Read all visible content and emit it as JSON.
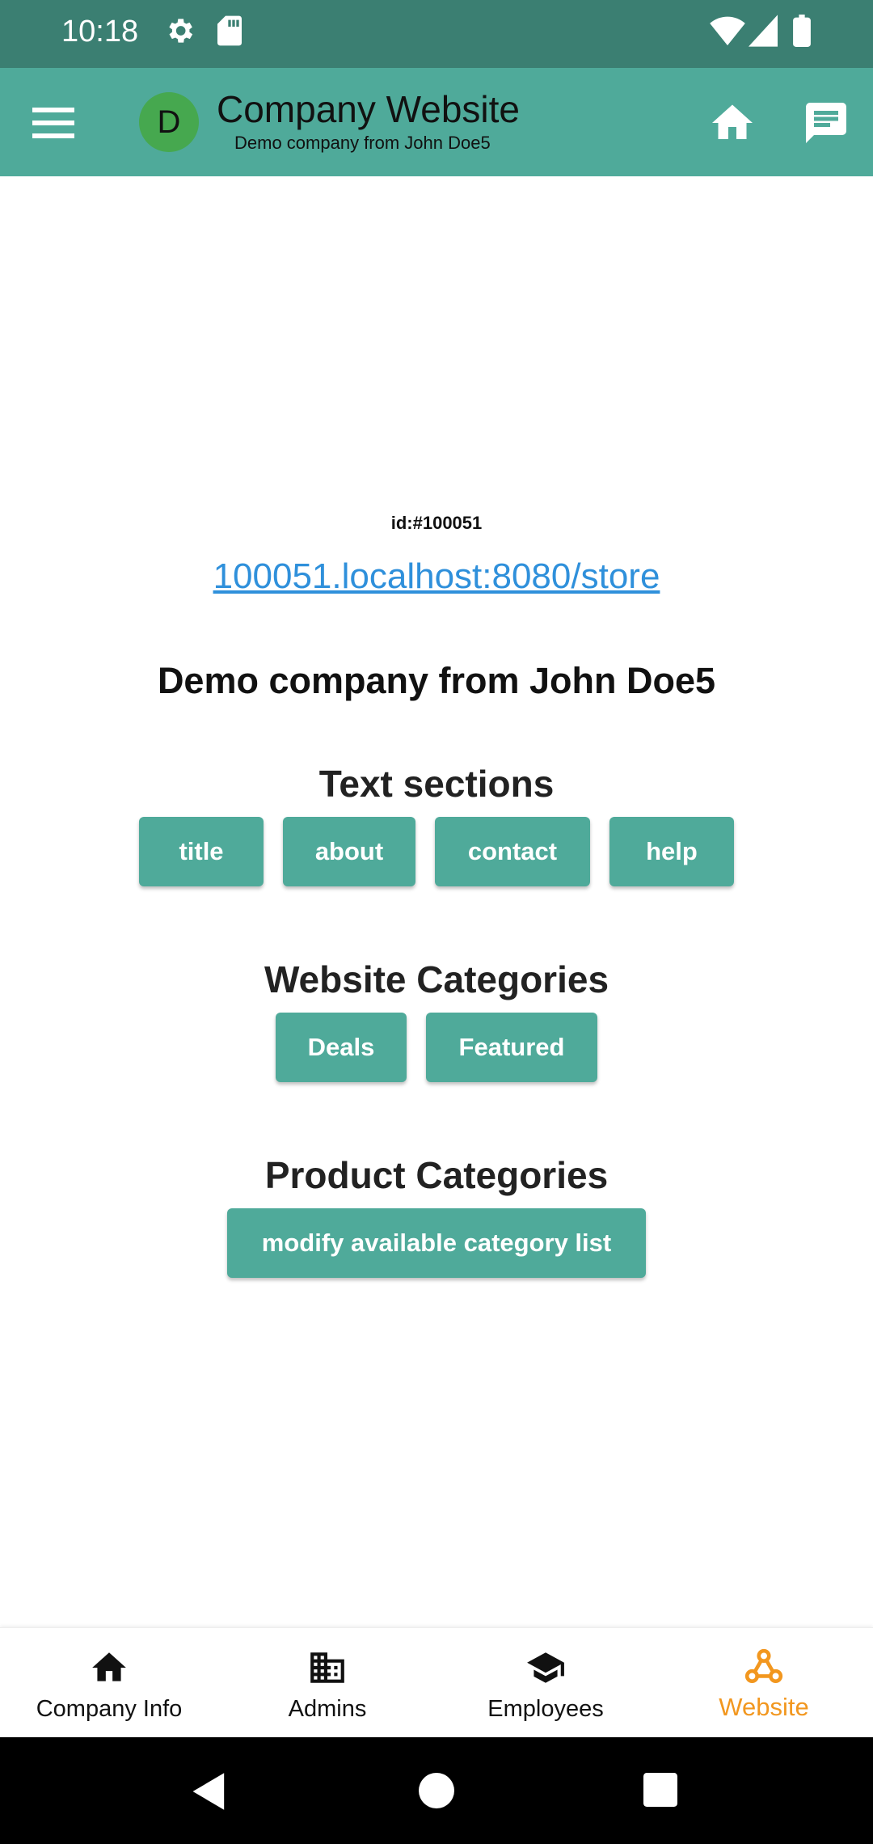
{
  "status_bar": {
    "time": "10:18"
  },
  "app_bar": {
    "avatar_letter": "D",
    "title": "Company Website",
    "subtitle": "Demo company from John Doe5"
  },
  "content": {
    "company_id": "id:#100051",
    "store_link": "100051.localhost:8080/store",
    "company_name": "Demo company from John Doe5",
    "text_sections": {
      "title": "Text sections",
      "buttons": [
        "title",
        "about",
        "contact",
        "help"
      ]
    },
    "website_categories": {
      "title": "Website Categories",
      "buttons": [
        "Deals",
        "Featured"
      ]
    },
    "product_categories": {
      "title": "Product Categories",
      "button": "modify available category list"
    }
  },
  "bottom_nav": {
    "items": [
      {
        "label": "Company Info",
        "icon": "home-icon"
      },
      {
        "label": "Admins",
        "icon": "building-icon"
      },
      {
        "label": "Employees",
        "icon": "school-icon"
      },
      {
        "label": "Website",
        "icon": "webhook-icon"
      }
    ],
    "active_index": 3,
    "active_color": "#f2971f"
  },
  "colors": {
    "status_bar": "#3b7f72",
    "app_bar": "#4faa9a",
    "button": "#4faa9a",
    "link": "#2f90db",
    "avatar": "#46a84f"
  }
}
